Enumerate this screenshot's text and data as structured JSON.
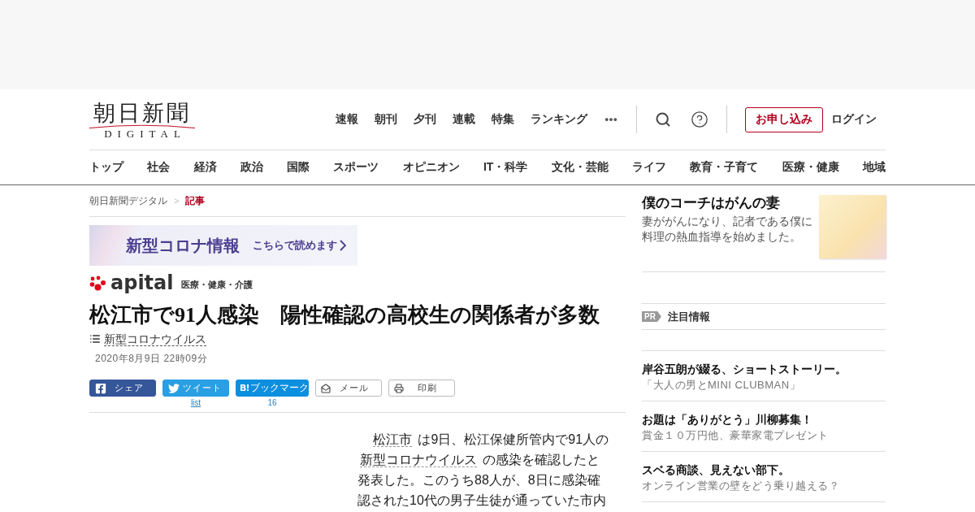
{
  "header": {
    "logo": {
      "title": "朝日新聞",
      "subtitle": "DIGITAL"
    },
    "top_nav": [
      {
        "label": "速報"
      },
      {
        "label": "朝刊"
      },
      {
        "label": "夕刊"
      },
      {
        "label": "連載"
      },
      {
        "label": "特集"
      },
      {
        "label": "ランキング"
      }
    ],
    "subscribe_button": "お申し込み",
    "login_link": "ログイン"
  },
  "category_nav": [
    {
      "label": "トップ"
    },
    {
      "label": "社会"
    },
    {
      "label": "経済"
    },
    {
      "label": "政治"
    },
    {
      "label": "国際"
    },
    {
      "label": "スポーツ"
    },
    {
      "label": "オピニオン"
    },
    {
      "label": "IT・科学"
    },
    {
      "label": "文化・芸能"
    },
    {
      "label": "ライフ"
    },
    {
      "label": "教育・子育て"
    },
    {
      "label": "医療・健康"
    },
    {
      "label": "地域"
    }
  ],
  "breadcrumb": {
    "separator": ">",
    "items": [
      {
        "label": "朝日新聞デジタル",
        "current": false
      },
      {
        "label": "記事",
        "current": true
      }
    ]
  },
  "promo_banner": {
    "title": "新型コロナ情報",
    "link": "こちらで読めます"
  },
  "section_logo": {
    "name": "apital",
    "category": "医療・健康・介護"
  },
  "article": {
    "headline": "松江市で91人感染　陽性確認の高校生の関係者が多数",
    "topic": "新型コロナウイルス",
    "date": "2020年8月9日 22時09分",
    "share_buttons": [
      {
        "kind": "facebook",
        "label": "シェア"
      },
      {
        "kind": "twitter",
        "label": "ツイート",
        "count": "list"
      },
      {
        "kind": "hatena",
        "logo": "B!",
        "label": "ブックマーク",
        "count": "16"
      },
      {
        "kind": "mail",
        "label": "メール"
      },
      {
        "kind": "print",
        "label": "印刷"
      }
    ],
    "body": [
      {
        "kind": "link",
        "text": "松江市"
      },
      {
        "kind": "text",
        "text": " は9日、松江保健所管内で91人の "
      },
      {
        "kind": "link",
        "text": "新型コロナウイルス"
      },
      {
        "kind": "text",
        "text": " の感染を確認したと発表した。このうち88人が、8日に感染確認された10代の男子生徒が通っていた市内"
      }
    ]
  },
  "sidebar": {
    "feature": {
      "title": "僕のコーチはがんの妻",
      "description": "妻ががんになり、記者である僕に料理の熱血指導を始めました。"
    },
    "pr_label": "PR",
    "pr_heading": "注目情報",
    "pr_items": [
      {
        "title": "岸谷五朗が綴る、ショートストーリー。",
        "subtitle": "「大人の男とMINI CLUBMAN」"
      },
      {
        "title": "お題は「ありがとう」川柳募集！",
        "subtitle": "賞金１０万円他、豪華家電プレゼント"
      },
      {
        "title": "スベる商談、見えない部下。",
        "subtitle": "オンライン営業の壁をどう乗り越える？"
      }
    ]
  }
}
